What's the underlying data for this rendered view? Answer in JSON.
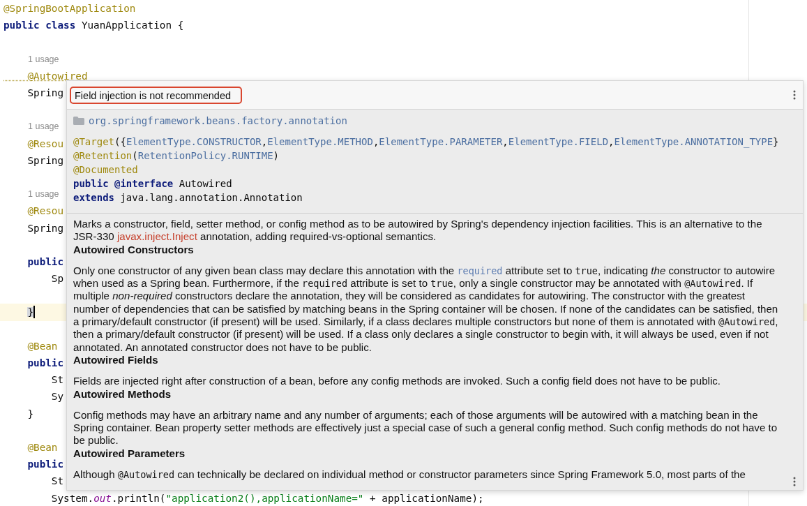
{
  "editor": {
    "lines": [
      {
        "current": false,
        "segments": [
          {
            "kind": "annotation",
            "text": "@SpringBootApplication"
          }
        ]
      },
      {
        "current": false,
        "segments": [
          {
            "kind": "keyword",
            "text": "public class "
          },
          {
            "kind": "plain",
            "text": "YuanApplication {"
          }
        ]
      },
      {
        "current": false
      },
      {
        "current": false,
        "segments": [
          {
            "kind": "hint",
            "text": "1 usage"
          }
        ]
      },
      {
        "current": false,
        "segments": [
          {
            "kind": "annotation-warning",
            "text": "    @Autowired"
          }
        ]
      },
      {
        "current": false,
        "segments": [
          {
            "kind": "plain",
            "text": "    Spring"
          }
        ]
      },
      {
        "current": false
      },
      {
        "current": false,
        "segments": [
          {
            "kind": "hint",
            "text": "1 usage"
          }
        ]
      },
      {
        "current": false,
        "segments": [
          {
            "kind": "annotation",
            "text": "    @Resou"
          }
        ]
      },
      {
        "current": false,
        "segments": [
          {
            "kind": "plain",
            "text": "    Spring"
          }
        ]
      },
      {
        "current": false
      },
      {
        "current": false,
        "segments": [
          {
            "kind": "hint",
            "text": "1 usage"
          }
        ]
      },
      {
        "current": false,
        "segments": [
          {
            "kind": "annotation",
            "text": "    @Resou"
          }
        ]
      },
      {
        "current": false,
        "segments": [
          {
            "kind": "plain",
            "text": "    Spring"
          }
        ]
      },
      {
        "current": false
      },
      {
        "current": false,
        "segments": [
          {
            "kind": "keyword",
            "text": "    public"
          }
        ]
      },
      {
        "current": false,
        "segments": [
          {
            "kind": "plain",
            "text": "        Sp"
          }
        ]
      },
      {
        "current": false
      },
      {
        "current": true,
        "segments": [
          {
            "kind": "brace-match",
            "text": "}"
          }
        ]
      },
      {
        "current": false
      },
      {
        "current": false,
        "segments": [
          {
            "kind": "annotation",
            "text": "    @Bean"
          }
        ]
      },
      {
        "current": false,
        "segments": [
          {
            "kind": "keyword",
            "text": "    public"
          }
        ]
      },
      {
        "current": false,
        "segments": [
          {
            "kind": "plain",
            "text": "        St"
          }
        ]
      },
      {
        "current": false,
        "segments": [
          {
            "kind": "plain",
            "text": "        Sy"
          }
        ]
      },
      {
        "current": false,
        "segments": [
          {
            "kind": "plain",
            "text": "    }"
          }
        ]
      },
      {
        "current": false
      },
      {
        "current": false,
        "segments": [
          {
            "kind": "annotation",
            "text": "    @Bean"
          }
        ]
      },
      {
        "current": false,
        "segments": [
          {
            "kind": "keyword",
            "text": "    public"
          }
        ]
      },
      {
        "current": false,
        "segments": [
          {
            "kind": "plain",
            "text": "        St"
          }
        ]
      },
      {
        "current": false,
        "segments": [
          {
            "kind": "plain",
            "text": "        System."
          },
          {
            "kind": "static",
            "text": "out"
          },
          {
            "kind": "plain",
            "text": ".println("
          },
          {
            "kind": "string",
            "text": "\"application2(),applicationName=\""
          },
          {
            "kind": "plain",
            "text": " + applicationName);"
          }
        ]
      }
    ]
  },
  "popup": {
    "title": "Field injection is not recommended",
    "package": "org.springframework.beans.factory.annotation",
    "declaration": [
      [
        {
          "kind": "annotation",
          "text": "@Target"
        },
        {
          "kind": "plain",
          "text": "({"
        },
        {
          "kind": "constant",
          "text": "ElementType.CONSTRUCTOR"
        },
        {
          "kind": "plain",
          "text": ","
        },
        {
          "kind": "constant",
          "text": "ElementType.METHOD"
        },
        {
          "kind": "plain",
          "text": ","
        },
        {
          "kind": "constant",
          "text": "ElementType.PARAMETER"
        },
        {
          "kind": "plain",
          "text": ","
        },
        {
          "kind": "constant",
          "text": "ElementType.FIELD"
        },
        {
          "kind": "plain",
          "text": ","
        },
        {
          "kind": "constant",
          "text": "ElementType.ANNOTATION_TYPE"
        },
        {
          "kind": "plain",
          "text": "}"
        }
      ],
      [
        {
          "kind": "annotation",
          "text": "@Retention"
        },
        {
          "kind": "plain",
          "text": "("
        },
        {
          "kind": "constant",
          "text": "RetentionPolicy.RUNTIME"
        },
        {
          "kind": "plain",
          "text": ")"
        }
      ],
      [
        {
          "kind": "annotation",
          "text": "@Documented"
        }
      ],
      [
        {
          "kind": "keyword",
          "text": "public @interface "
        },
        {
          "kind": "plain",
          "text": "Autowired"
        }
      ],
      [
        {
          "kind": "keyword",
          "text": "extends "
        },
        {
          "kind": "plain",
          "text": "java.lang.annotation.Annotation"
        }
      ]
    ],
    "blocks": [
      {
        "kind": "paragraph",
        "segments": [
          {
            "kind": "text",
            "text": "Marks a constructor, field, setter method, or config method as to be autowired by Spring's dependency injection facilities. This is an alternative to the JSR-330 "
          },
          {
            "kind": "link",
            "text": "javax.inject.Inject"
          },
          {
            "kind": "text",
            "text": " annotation, adding required-vs-optional semantics."
          }
        ]
      },
      {
        "kind": "heading",
        "text": "Autowired Constructors"
      },
      {
        "kind": "paragraph",
        "segments": [
          {
            "kind": "text",
            "text": "Only one constructor of any given bean class may declare this annotation with the "
          },
          {
            "kind": "code-link",
            "text": "required"
          },
          {
            "kind": "text",
            "text": " attribute set to "
          },
          {
            "kind": "code",
            "text": "true"
          },
          {
            "kind": "text",
            "text": ", indicating "
          },
          {
            "kind": "italic",
            "text": "the"
          },
          {
            "kind": "text",
            "text": " constructor to autowire when used as a Spring bean. Furthermore, if the "
          },
          {
            "kind": "code",
            "text": "required"
          },
          {
            "kind": "text",
            "text": " attribute is set to "
          },
          {
            "kind": "code",
            "text": "true"
          },
          {
            "kind": "text",
            "text": ", only a single constructor may be annotated with "
          },
          {
            "kind": "code",
            "text": "@Autowired"
          },
          {
            "kind": "text",
            "text": ". If multiple "
          },
          {
            "kind": "italic",
            "text": "non-required"
          },
          {
            "kind": "text",
            "text": " constructors declare the annotation, they will be considered as candidates for autowiring. The constructor with the greatest number of dependencies that can be satisfied by matching beans in the Spring container will be chosen. If none of the candidates can be satisfied, then a primary/default constructor (if present) will be used. Similarly, if a class declares multiple constructors but none of them is annotated with "
          },
          {
            "kind": "code",
            "text": "@Autowired"
          },
          {
            "kind": "text",
            "text": ", then a primary/default constructor (if present) will be used. If a class only declares a single constructor to begin with, it will always be used, even if not annotated. An annotated constructor does not have to be public."
          }
        ]
      },
      {
        "kind": "heading",
        "text": "Autowired Fields"
      },
      {
        "kind": "paragraph",
        "segments": [
          {
            "kind": "text",
            "text": "Fields are injected right after construction of a bean, before any config methods are invoked. Such a config field does not have to be public."
          }
        ]
      },
      {
        "kind": "heading",
        "text": "Autowired Methods"
      },
      {
        "kind": "paragraph",
        "segments": [
          {
            "kind": "text",
            "text": "Config methods may have an arbitrary name and any number of arguments; each of those arguments will be autowired with a matching bean in the Spring container. Bean property setter methods are effectively just a special case of such a general config method. Such config methods do not have to be public."
          }
        ]
      },
      {
        "kind": "heading",
        "text": "Autowired Parameters"
      },
      {
        "kind": "paragraph",
        "segments": [
          {
            "kind": "text",
            "text": "Although "
          },
          {
            "kind": "code",
            "text": "@Autowired"
          },
          {
            "kind": "text",
            "text": " can technically be declared on individual method or constructor parameters since Spring Framework 5.0, most parts of the"
          }
        ]
      }
    ]
  }
}
